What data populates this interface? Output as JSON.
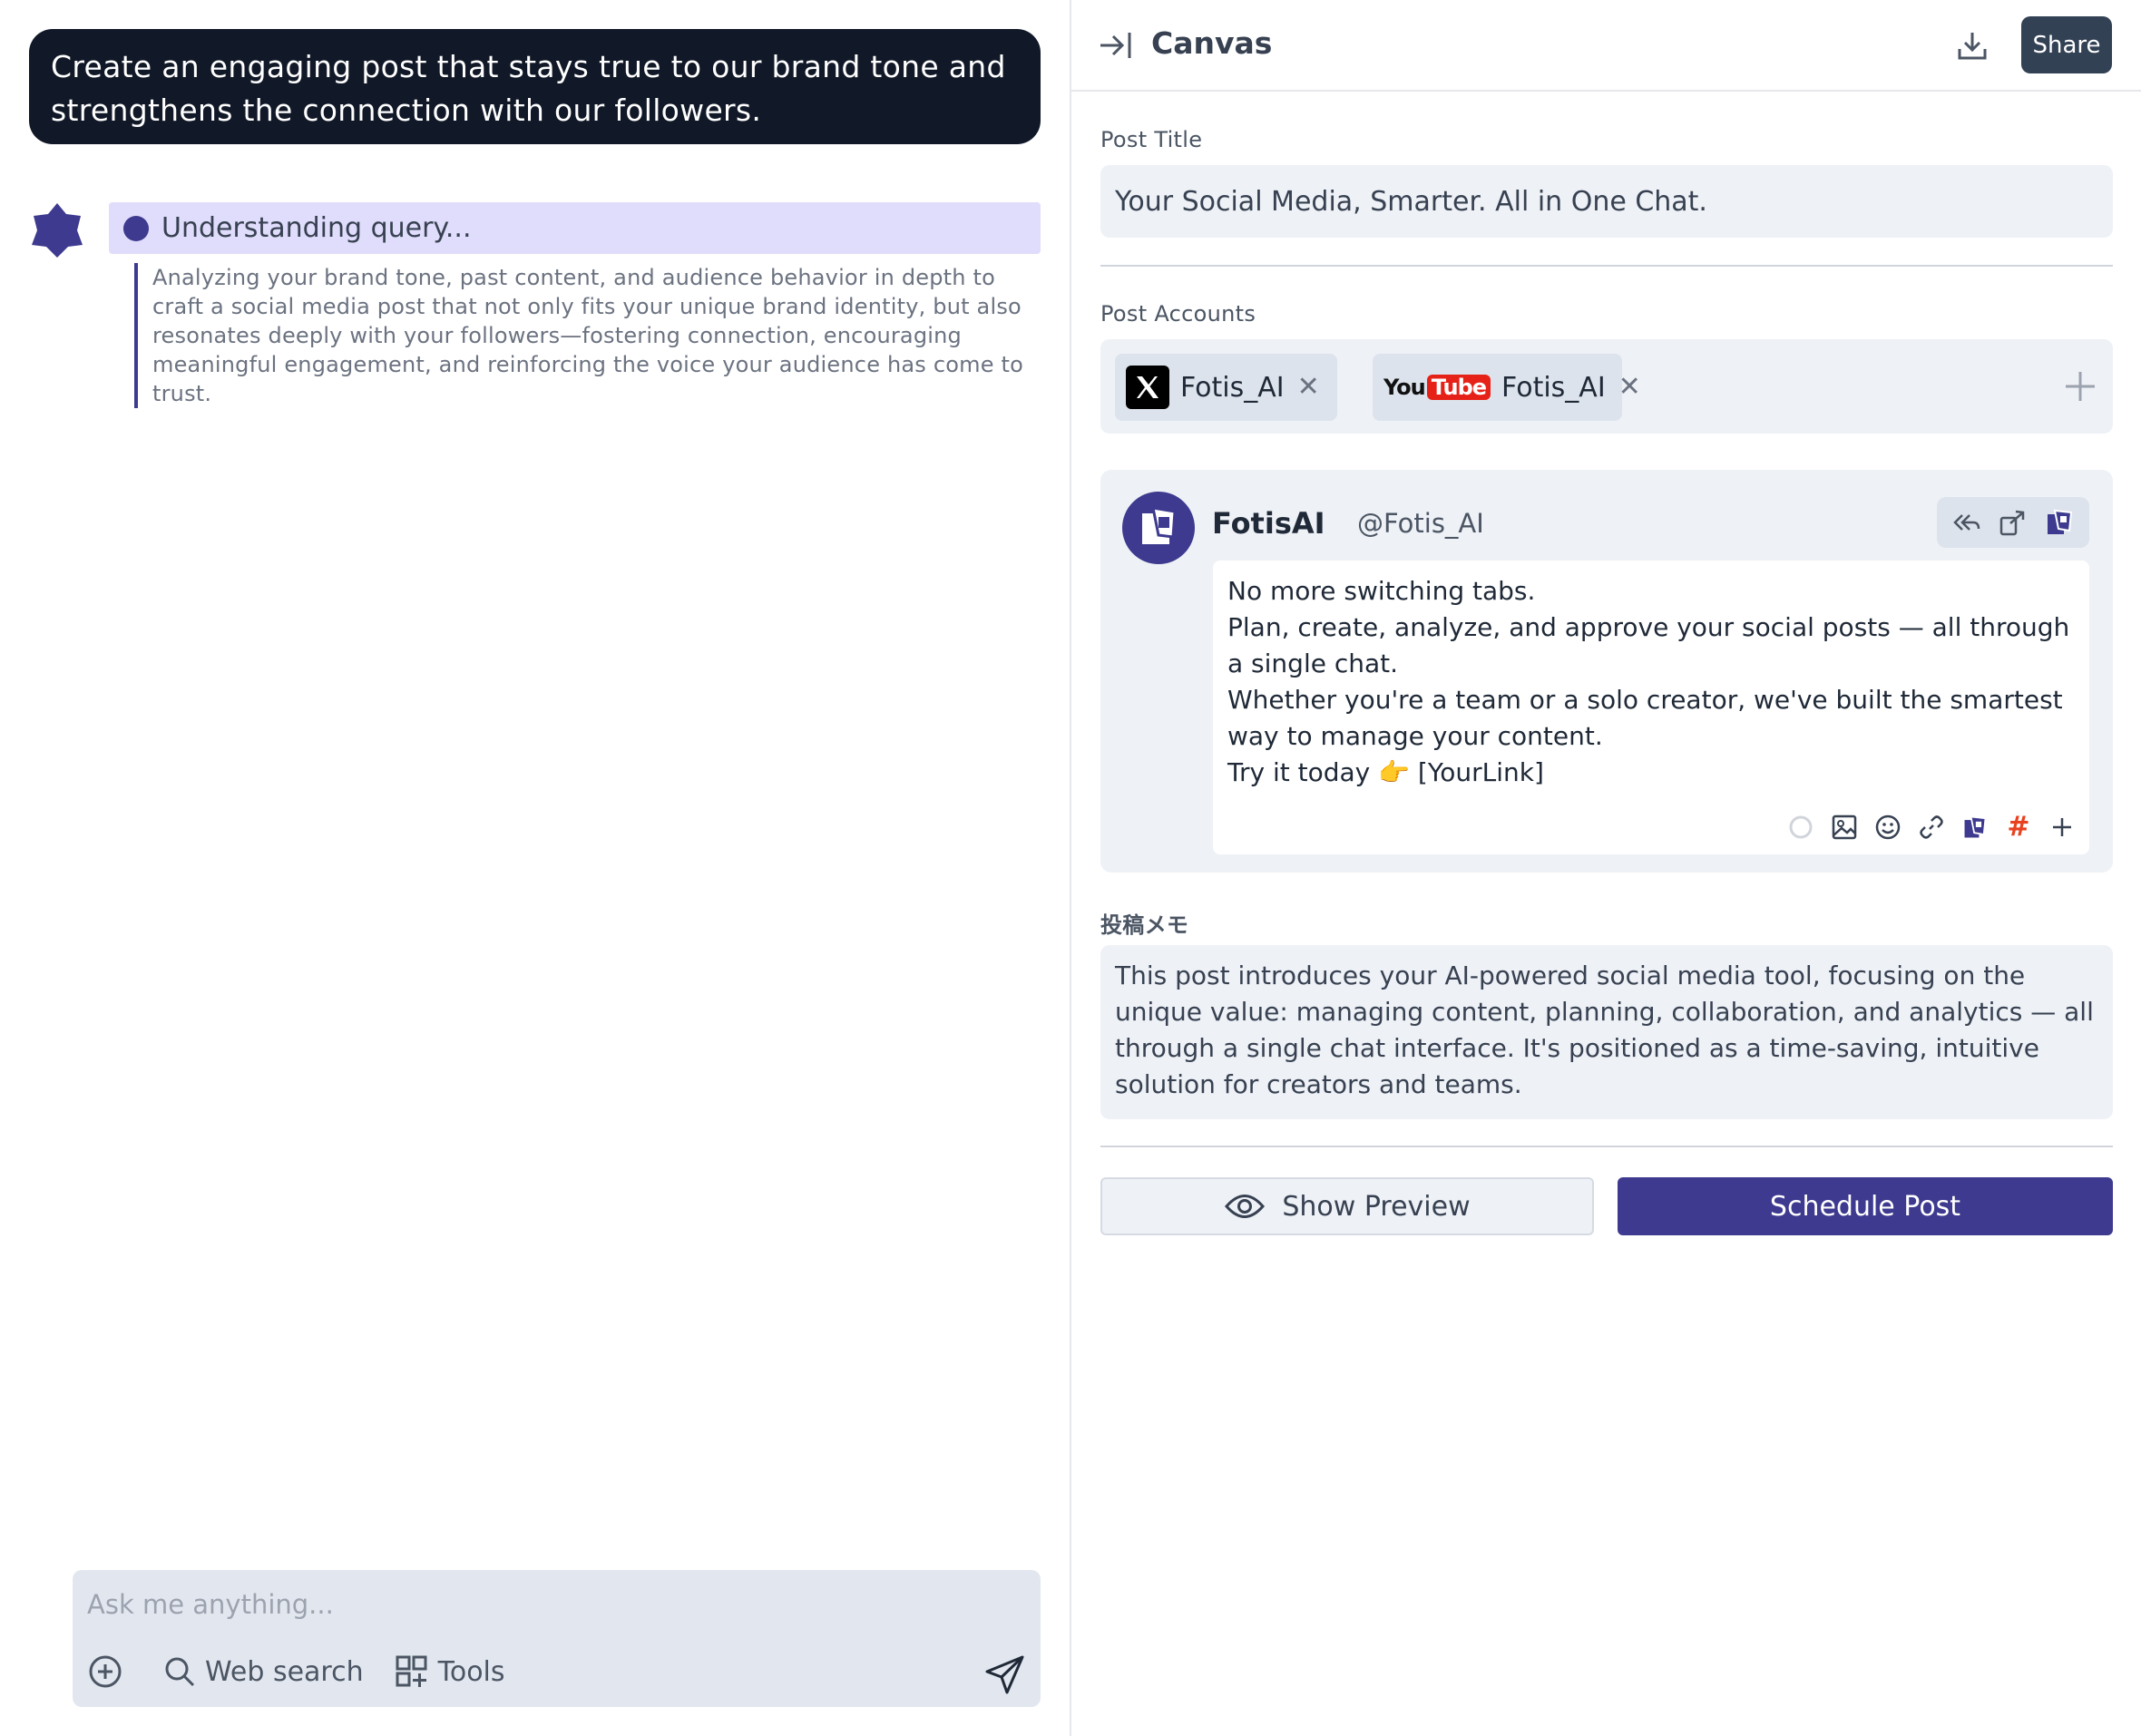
{
  "chat": {
    "user_message": "Create an engaging post that stays true to our brand tone and strengthens the connection with our followers.",
    "status": "Understanding query...",
    "thinking": "Analyzing your brand tone, past content, and audience behavior in depth to craft a social media post that not only fits your unique brand identity, but also resonates deeply with your followers—fostering connection, encouraging meaningful engagement, and reinforcing the voice your audience has come to trust.",
    "composer": {
      "placeholder": "Ask me anything...",
      "web_search": "Web search",
      "tools": "Tools"
    }
  },
  "canvas": {
    "title": "Canvas",
    "share_label": "Share",
    "post_title_label": "Post Title",
    "post_title_value": "Your Social Media, Smarter. All in One Chat.",
    "accounts_label": "Post Accounts",
    "accounts": [
      {
        "platform": "X",
        "name": "Fotis_AI"
      },
      {
        "platform": "YouTube",
        "name": "Fotis_AI",
        "logo_you": "You",
        "logo_tube": "Tube"
      }
    ],
    "post": {
      "display_name": "FotisAI",
      "handle": "@Fotis_AI",
      "lines": [
        "No more switching tabs.",
        " Plan, create, analyze, and approve your social posts — all through a single chat.",
        " Whether you're a team or a solo creator, we've built the smartest way to manage your content.",
        " Try it today 👉 [YourLink]"
      ],
      "hashtag_symbol": "#"
    },
    "memo_label": "投稿メモ",
    "memo_text": "This post introduces your AI-powered social media tool, focusing on the unique value: managing content, planning, collaboration, and analytics — all through a single chat interface. It's positioned as a time-saving, intuitive solution for creators and teams.",
    "preview_label": "Show Preview",
    "schedule_label": "Schedule Post"
  },
  "colors": {
    "accent": "#3d3a8f",
    "user_bubble": "#111827",
    "status_bg": "#e0dcfb",
    "field_bg": "#eef1f6",
    "hashtag": "#e8411f"
  }
}
